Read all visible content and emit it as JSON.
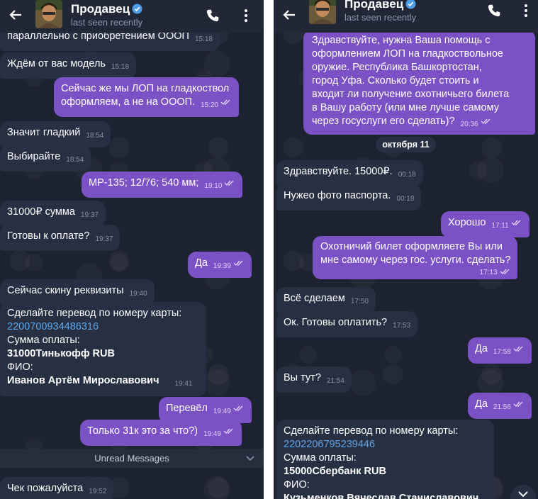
{
  "chat": {
    "contact_name": "Продавец",
    "status": "last seen recently"
  },
  "left": {
    "m0": {
      "text": "параллельно с приобретением ОООП",
      "time": "15:18"
    },
    "m1": {
      "text": "Ждём от вас модель",
      "time": "15:18"
    },
    "m2": {
      "lines": [
        "Сейчас же мы ЛОП на гладкоствол",
        "оформляем, а не на ОООП."
      ],
      "time": "15:20"
    },
    "m3": {
      "text": "Значит гладкий",
      "time": "18:54"
    },
    "m4": {
      "text": "Выбирайте",
      "time": "18:54"
    },
    "m5": {
      "text": "МР-135; 12/76; 540 мм;",
      "time": "19:10"
    },
    "m6": {
      "text": "31000₽ сумма",
      "time": "19:37"
    },
    "m7": {
      "text": "Готовы к оплате?",
      "time": "19:37"
    },
    "m8": {
      "text": "Да",
      "time": "19:39"
    },
    "m9": {
      "text": "Сейчас скину реквизиты",
      "time": "19:40"
    },
    "m10": {
      "line1": "Сделайте перевод по номеру карты:",
      "card": "2200700934486316",
      "line3": "Сумма оплаты:",
      "line4": "31000Тинькофф RUB",
      "line5": "ФИО:",
      "line6": "Иванов Артём Мирославович",
      "time": "19:41"
    },
    "m11": {
      "text": "Перевёл",
      "time": "19:49"
    },
    "m12": {
      "text": "Только 31к это за что?)",
      "time": "19:49"
    },
    "unread_label": "Unread Messages",
    "m13": {
      "text": "Чек пожалуйста",
      "time": "19:52"
    }
  },
  "right": {
    "m0": {
      "lines": [
        "Здравствуйте, нужна Ваша помощь с",
        "оформлением ЛОП на гладкоствольное",
        "оружие. Республика Башкортостан,",
        "город Уфа. Сколько будет стоить и",
        "входит ли получение охотничьего билета",
        "в Вашу работу (или мне лучше самому",
        "через госуслуги его сделать)?"
      ],
      "time": "20:36"
    },
    "date": "октября 11",
    "m1": {
      "text": "Здравствуйте. 15000₽.",
      "time": "00:18"
    },
    "m2": {
      "text": "Нужео фото паспорта.",
      "time": "00:18"
    },
    "m3": {
      "text": "Хорошо",
      "time": "17:11"
    },
    "m4": {
      "lines": [
        "Охотничий билет оформляете Вы или",
        "мне самому через гос. услуги. сделать?"
      ],
      "time": "17:13"
    },
    "m5": {
      "text": "Всё сделаем",
      "time": "17:50"
    },
    "m6": {
      "text": "Ок. Готовы оплатить?",
      "time": "17:53"
    },
    "m7": {
      "text": "Да",
      "time": "17:58"
    },
    "m8": {
      "text": "Вы тут?",
      "time": "21:54"
    },
    "m9": {
      "text": "Да",
      "time": "21:56"
    },
    "m10": {
      "line1": "Сделайте перевод по номеру карты:",
      "card": "2202206795239446",
      "line3": "Сумма оплаты:",
      "line4": "15000Сбербанк RUB",
      "line5": "ФИО:",
      "line6": "Кузьменков Вячеслав Станиславович"
    }
  },
  "colors": {
    "background": "#1d2230",
    "header": "#212736",
    "incoming_bubble": "#273042",
    "outgoing_bubble": "#7b52c6",
    "link": "#5fa6ea"
  },
  "icons": [
    "back-arrow-icon",
    "verified-icon",
    "phone-icon",
    "more-vertical-icon",
    "double-check-icon",
    "chevron-down-icon"
  ]
}
